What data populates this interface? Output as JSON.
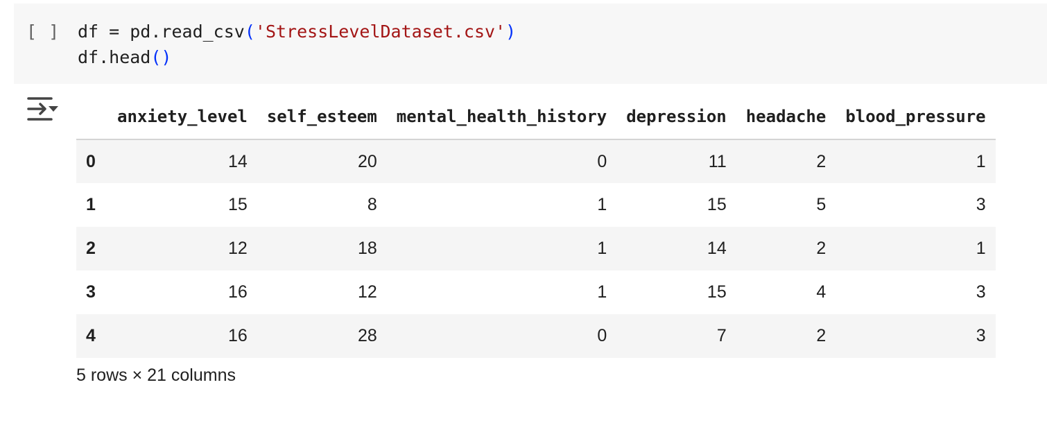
{
  "cell": {
    "execution_count": "[ ]",
    "code_lines": [
      {
        "prefix": "df = pd.read_csv",
        "open_paren": "(",
        "string": "'StressLevelDataset.csv'",
        "close_paren": ")"
      },
      {
        "prefix": "df.head",
        "open_paren": "(",
        "string": "",
        "close_paren": ")"
      }
    ]
  },
  "output": {
    "toggle_icon": "output-collapse-icon",
    "columns": [
      "anxiety_level",
      "self_esteem",
      "mental_health_history",
      "depression",
      "headache",
      "blood_pressure"
    ],
    "rows": [
      {
        "index": "0",
        "values": [
          "14",
          "20",
          "0",
          "11",
          "2",
          "1"
        ]
      },
      {
        "index": "1",
        "values": [
          "15",
          "8",
          "1",
          "15",
          "5",
          "3"
        ]
      },
      {
        "index": "2",
        "values": [
          "12",
          "18",
          "1",
          "14",
          "2",
          "1"
        ]
      },
      {
        "index": "3",
        "values": [
          "16",
          "12",
          "1",
          "15",
          "4",
          "3"
        ]
      },
      {
        "index": "4",
        "values": [
          "16",
          "28",
          "0",
          "7",
          "2",
          "3"
        ]
      }
    ],
    "shape_note": "5 rows × 21 columns"
  },
  "colors": {
    "cell_background": "#f7f7f7",
    "string_literal": "#a31515",
    "parenthesis": "#0431fa",
    "striped_row": "#f5f5f5"
  }
}
